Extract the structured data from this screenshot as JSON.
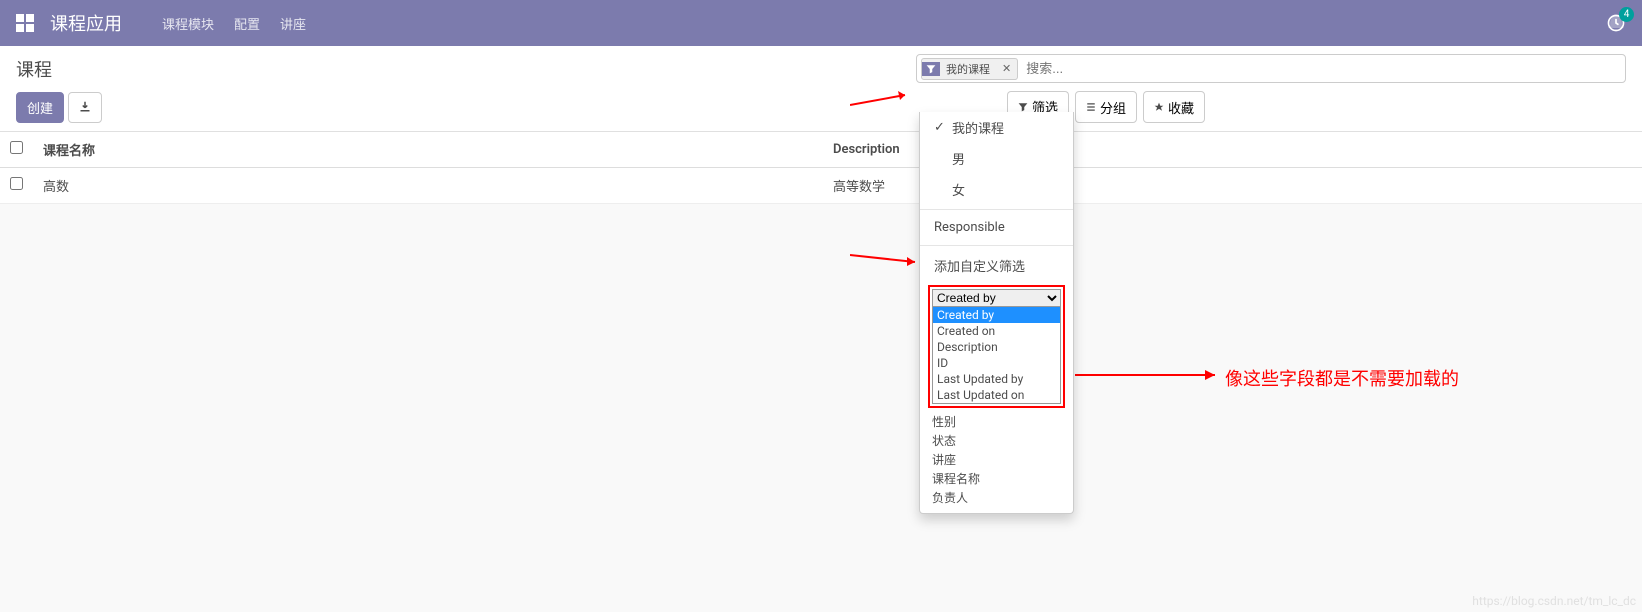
{
  "navbar": {
    "brand": "课程应用",
    "menu": [
      "课程模块",
      "配置",
      "讲座"
    ],
    "activity_count": "4"
  },
  "breadcrumb": "课程",
  "buttons": {
    "create": "创建"
  },
  "search": {
    "facet_label": "我的课程",
    "placeholder": "搜索..."
  },
  "filter_buttons": {
    "filter": "筛选",
    "group": "分组",
    "favorite": "收藏"
  },
  "table": {
    "headers": {
      "name": "课程名称",
      "description": "Description"
    },
    "rows": [
      {
        "name": "高数",
        "description": "高等数学"
      }
    ]
  },
  "filter_menu": {
    "items": [
      {
        "label": "我的课程",
        "checked": true
      },
      {
        "label": "男",
        "checked": false
      },
      {
        "label": "女",
        "checked": false
      }
    ],
    "responsible": "Responsible",
    "custom_filter_header": "添加自定义筛选",
    "selected_field": "Created by",
    "field_options_highlighted": [
      "Created by",
      "Created on",
      "Description",
      "ID",
      "Last Updated by",
      "Last Updated on"
    ],
    "field_options_rest": [
      "性别",
      "状态",
      "讲座",
      "课程名称",
      "负责人"
    ]
  },
  "annotation": "像这些字段都是不需要加载的",
  "watermark": "https://blog.csdn.net/tm_lc_dc"
}
